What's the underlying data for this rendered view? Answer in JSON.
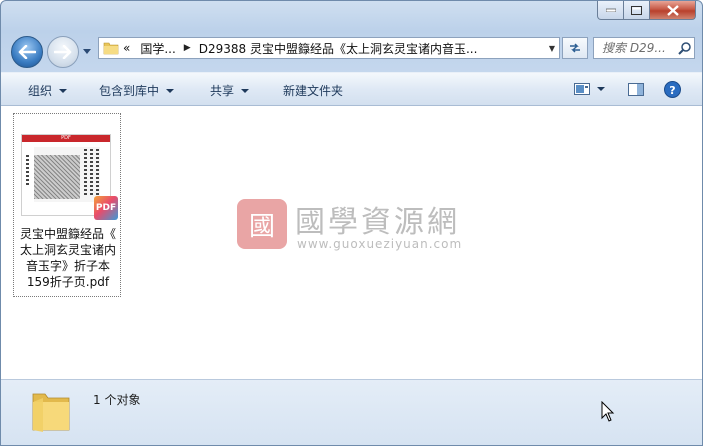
{
  "window": {
    "buttons": {
      "minimize": "minimize",
      "maximize": "maximize",
      "close": "close"
    }
  },
  "navigation": {
    "back_icon": "back-arrow-icon",
    "forward_icon": "forward-arrow-icon",
    "history_icon": "chevron-down-icon"
  },
  "address": {
    "overflow": "«",
    "crumbs": [
      "国学...",
      "D29388 灵宝中盟籙经品《太上洞玄灵宝诸内音玉..."
    ],
    "icon": "folder-icon"
  },
  "search": {
    "placeholder": "搜索 D29...",
    "icon": "magnifier-icon"
  },
  "toolbar": {
    "organize": "组织",
    "include_library": "包含到库中",
    "share": "共享",
    "new_folder": "新建文件夹",
    "view_icon": "view-options-icon",
    "preview_icon": "preview-pane-icon",
    "help_icon": "help-icon"
  },
  "file": {
    "name": "灵宝中盟籙经品《太上洞玄灵宝诸内音玉字》折子本159折子页.pdf",
    "name_lines": [
      "灵宝中盟籙经品《",
      "太上洞玄灵宝诸内",
      "音玉字》折子本",
      "159折子页.pdf"
    ],
    "thumb_header": "PDF",
    "badge": "PDF"
  },
  "watermark": {
    "seal": "國",
    "title": "國學資源網",
    "url": "www.guoxueziyuan.com"
  },
  "status": {
    "count_text": "1 个对象"
  },
  "colors": {
    "close_red": "#c75a47",
    "chrome_blue": "#bcd1ea",
    "toolbar_text": "#1e395b",
    "thumb_red": "#c9272c"
  }
}
